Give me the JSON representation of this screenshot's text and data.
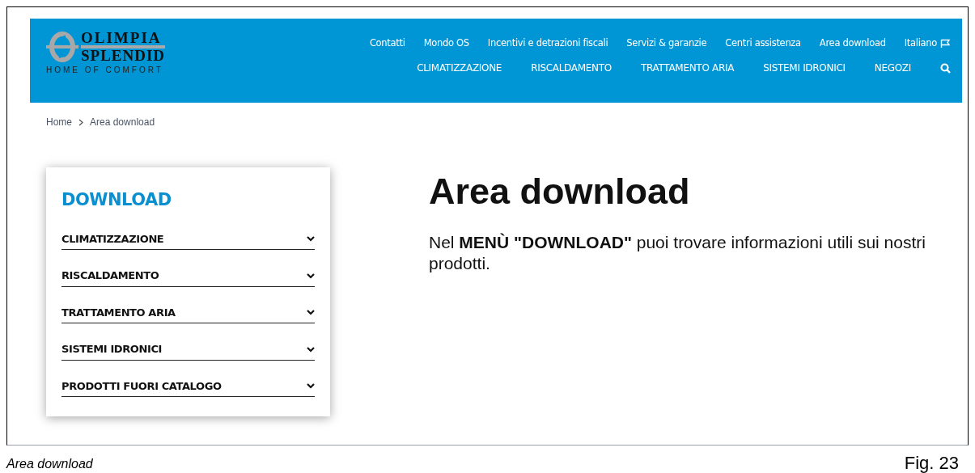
{
  "header": {
    "logo": {
      "line_1": "OLIMPIA",
      "line_2": "SPLENDID",
      "tagline": "HOME OF COMFORT"
    },
    "top_links": [
      "Contatti",
      "Mondo OS",
      "Incentivi e detrazioni fiscali",
      "Servizi & garanzie",
      "Centri assistenza",
      "Area download",
      "Italiano"
    ],
    "main_menu": [
      "CLIMATIZZAZIONE",
      "RISCALDAMENTO",
      "TRATTAMENTO ARIA",
      "SISTEMI IDRONICI",
      "NEGOZI"
    ]
  },
  "breadcrumb": [
    "Home",
    "Area download"
  ],
  "sidebar": {
    "title": "DOWNLOAD",
    "items": [
      {
        "label": "CLIMATIZZAZIONE",
        "expanded": false
      },
      {
        "label": "RISCALDAMENTO",
        "expanded": false
      },
      {
        "label": "TRATTAMENTO ARIA",
        "expanded": false
      },
      {
        "label": "SISTEMI IDRONICI",
        "expanded": false
      },
      {
        "label": "PRODOTTI FUORI CATALOGO",
        "expanded": false
      }
    ]
  },
  "main": {
    "title": "Area download",
    "text": "Nel **MENÙ \"DOWNLOAD\"** puoi trovare informazioni utili sui nostri prodotti."
  },
  "caption": {
    "text": "Area download",
    "figure": "Fig. 23"
  }
}
